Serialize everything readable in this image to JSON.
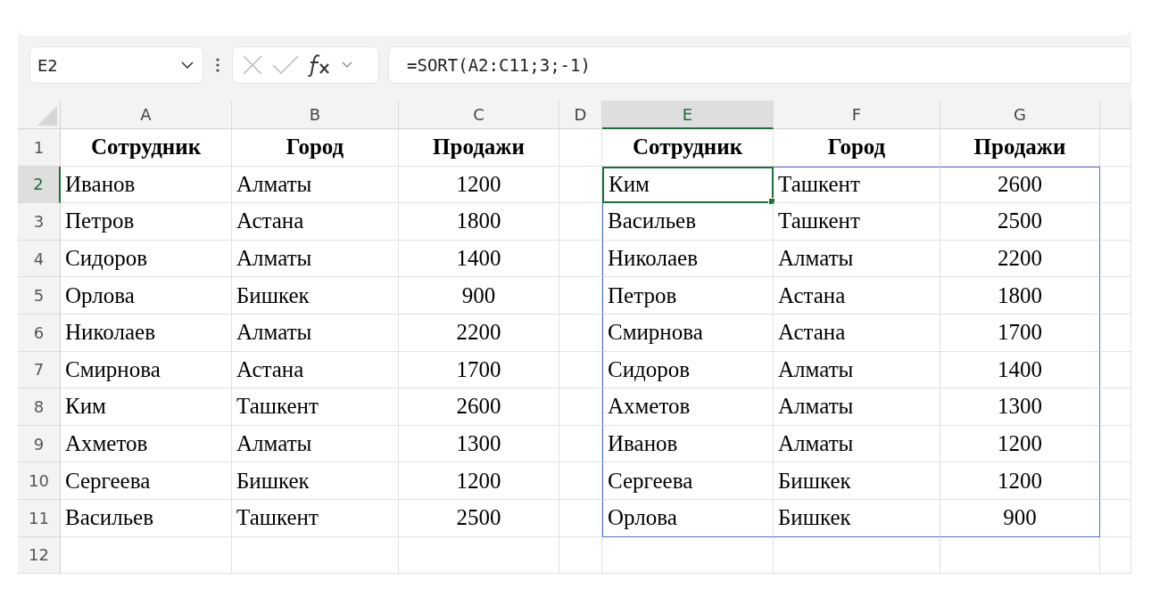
{
  "name_box": {
    "value": "E2"
  },
  "formula_bar": {
    "value": "=SORT(A2:C11;3;-1)"
  },
  "columns": [
    {
      "label": "A",
      "selected": false
    },
    {
      "label": "B",
      "selected": false
    },
    {
      "label": "C",
      "selected": false
    },
    {
      "label": "D",
      "selected": false
    },
    {
      "label": "E",
      "selected": true
    },
    {
      "label": "F",
      "selected": false
    },
    {
      "label": "G",
      "selected": false
    }
  ],
  "row_numbers": [
    {
      "label": "1",
      "selected": false
    },
    {
      "label": "2",
      "selected": true
    },
    {
      "label": "3",
      "selected": false
    },
    {
      "label": "4",
      "selected": false
    },
    {
      "label": "5",
      "selected": false
    },
    {
      "label": "6",
      "selected": false
    },
    {
      "label": "7",
      "selected": false
    },
    {
      "label": "8",
      "selected": false
    },
    {
      "label": "9",
      "selected": false
    },
    {
      "label": "10",
      "selected": false
    },
    {
      "label": "11",
      "selected": false
    },
    {
      "label": "12",
      "selected": false
    }
  ],
  "source_table": {
    "header": [
      "Сотрудник",
      "Город",
      "Продажи"
    ],
    "rows": [
      [
        "Иванов",
        "Алматы",
        "1200"
      ],
      [
        "Петров",
        "Астана",
        "1800"
      ],
      [
        "Сидоров",
        "Алматы",
        "1400"
      ],
      [
        "Орлова",
        "Бишкек",
        "900"
      ],
      [
        "Николаев",
        "Алматы",
        "2200"
      ],
      [
        "Смирнова",
        "Астана",
        "1700"
      ],
      [
        "Ким",
        "Ташкент",
        "2600"
      ],
      [
        "Ахметов",
        "Алматы",
        "1300"
      ],
      [
        "Сергеева",
        "Бишкек",
        "1200"
      ],
      [
        "Васильев",
        "Ташкент",
        "2500"
      ]
    ]
  },
  "result_table": {
    "header": [
      "Сотрудник",
      "Город",
      "Продажи"
    ],
    "rows": [
      [
        {
          "text": "Ким",
          "selected": true
        },
        "Ташкент",
        "2600"
      ],
      [
        "Васильев",
        "Ташкент",
        "2500"
      ],
      [
        "Николаев",
        "Алматы",
        "2200"
      ],
      [
        "Петров",
        "Астана",
        "1800"
      ],
      [
        "Смирнова",
        "Астана",
        "1700"
      ],
      [
        "Сидоров",
        "Алматы",
        "1400"
      ],
      [
        "Ахметов",
        "Алматы",
        "1300"
      ],
      [
        "Иванов",
        "Алматы",
        "1200"
      ],
      [
        "Сергеева",
        "Бишкек",
        "1200"
      ],
      [
        "Орлова",
        "Бишкек",
        "900"
      ]
    ]
  }
}
